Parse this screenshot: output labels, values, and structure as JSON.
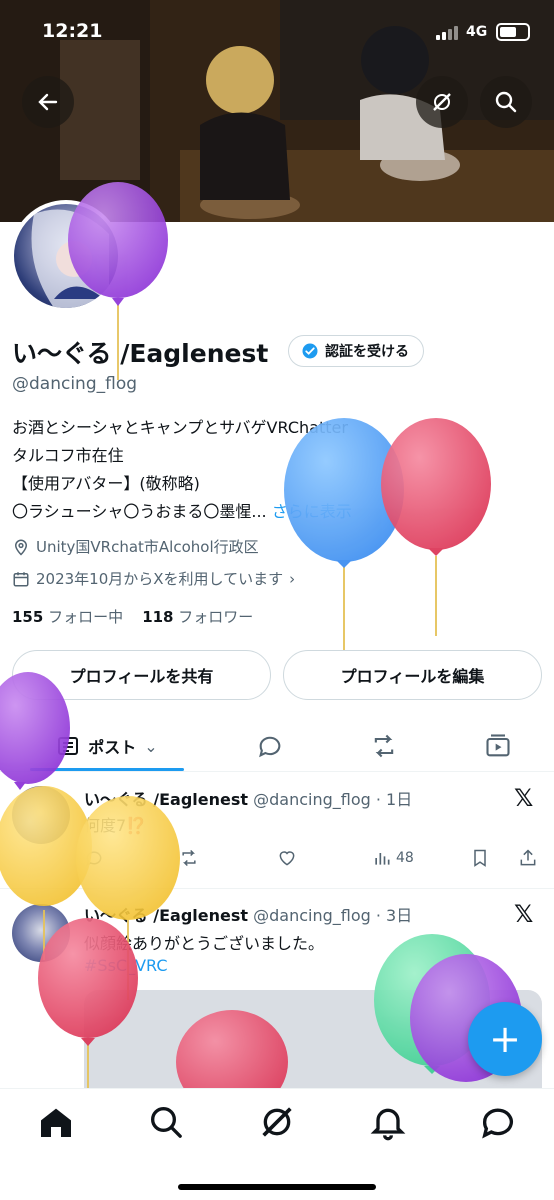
{
  "status_bar": {
    "time": "12:21",
    "network": "4G"
  },
  "profile": {
    "name": "い〜ぐる /Eaglenest",
    "verify_label": "認証を受ける",
    "handle": "@dancing_flog",
    "bio_lines": [
      "お酒とシーシャとキャンプとサバゲVRChatter",
      "タルコフ市在住",
      "【使用アバター】(敬称略)",
      "〇ラシューシャ〇うおまる〇墨惺..."
    ],
    "bio_more": "さらに表示",
    "location": "Unity国VRchat市Alcohol行政区",
    "joined": "2023年10月からXを利用しています",
    "following_count": "155",
    "following_label": "フォロー中",
    "followers_count": "118",
    "followers_label": "フォロワー",
    "share_button": "プロフィールを共有",
    "edit_button": "プロフィールを編集"
  },
  "tabs": {
    "posts_label": "ポスト"
  },
  "posts": [
    {
      "name": "い〜ぐる /Eaglenest",
      "handle_time": "@dancing_flog · 1日",
      "text": "何度7⁉️",
      "views": "48"
    },
    {
      "name": "い〜ぐる /Eaglenest",
      "handle_time": "@dancing_flog · 3日",
      "text": "似顔絵ありがとうございました。",
      "hashtag": "#SsC_VRC"
    }
  ],
  "icons": {
    "back": "back-arrow-icon",
    "grok": "grok-icon",
    "search": "search-icon",
    "verified": "verified-badge-icon",
    "location": "location-pin-icon",
    "calendar": "calendar-icon",
    "compose": "plus-icon"
  },
  "colors": {
    "accent": "#1d9bf0",
    "text": "#0f1419",
    "muted": "#536471"
  }
}
